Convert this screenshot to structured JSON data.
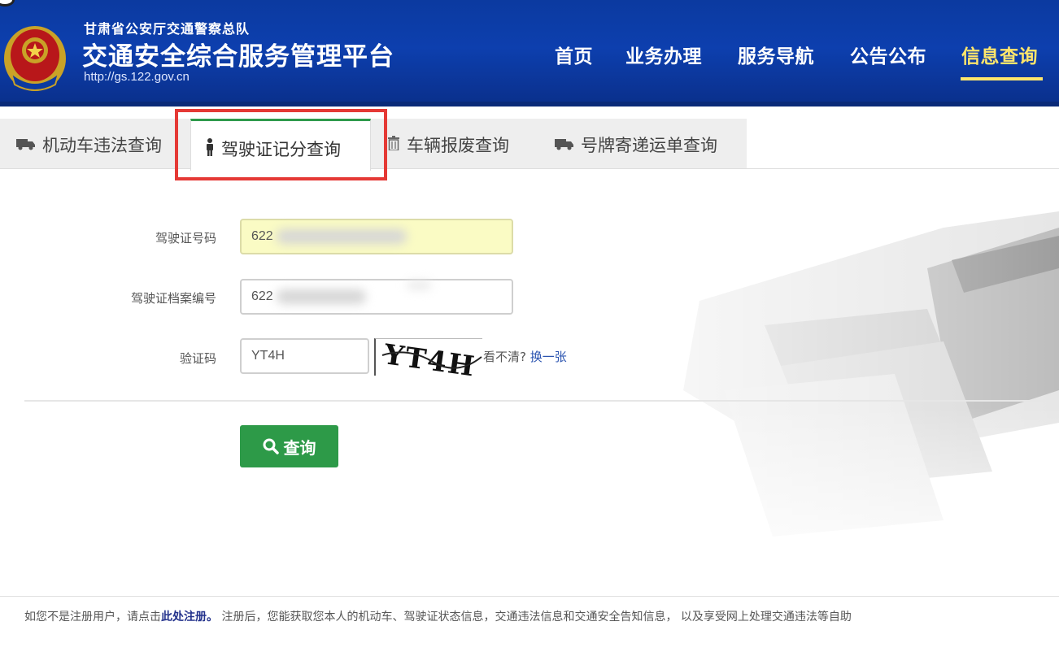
{
  "header": {
    "org_name": "甘肃省公安厅交通警察总队",
    "platform_title": "交通安全综合服务管理平台",
    "url": "http://gs.122.gov.cn",
    "nav": [
      {
        "label": "首页"
      },
      {
        "label": "业务办理"
      },
      {
        "label": "服务导航"
      },
      {
        "label": "公告公布"
      },
      {
        "label": "信息查询"
      }
    ],
    "active_nav": "信息查询"
  },
  "tabs": [
    {
      "label": "机动车违法查询",
      "icon": "truck-icon"
    },
    {
      "label": "驾驶证记分查询",
      "icon": "person-icon"
    },
    {
      "label": "车辆报废查询",
      "icon": "trash-icon"
    },
    {
      "label": "号牌寄递运单查询",
      "icon": "truck-icon"
    }
  ],
  "active_tab": "驾驶证记分查询",
  "form": {
    "license_no_label": "驾驶证号码",
    "license_no_value": "622",
    "file_no_label": "驾驶证档案编号",
    "file_no_value": "622",
    "captcha_label": "验证码",
    "captcha_value": "YT4H",
    "captcha_image_text": "YT4H",
    "hint_text": "看不清?",
    "refresh_link": "换一张",
    "submit_label": "查询"
  },
  "footer": {
    "text_before": "如您不是注册用户，请点击",
    "register_link": "此处注册。",
    "text_after": " 注册后，您能获取您本人的机动车、驾驶证状态信息，交通违法信息和交通安全告知信息， 以及享受网上处理交通违法等自助"
  },
  "colors": {
    "header_blue": "#0d3fae",
    "nav_active": "#ffe66b",
    "button_green": "#2d9a48",
    "highlight_red": "#e53935"
  }
}
